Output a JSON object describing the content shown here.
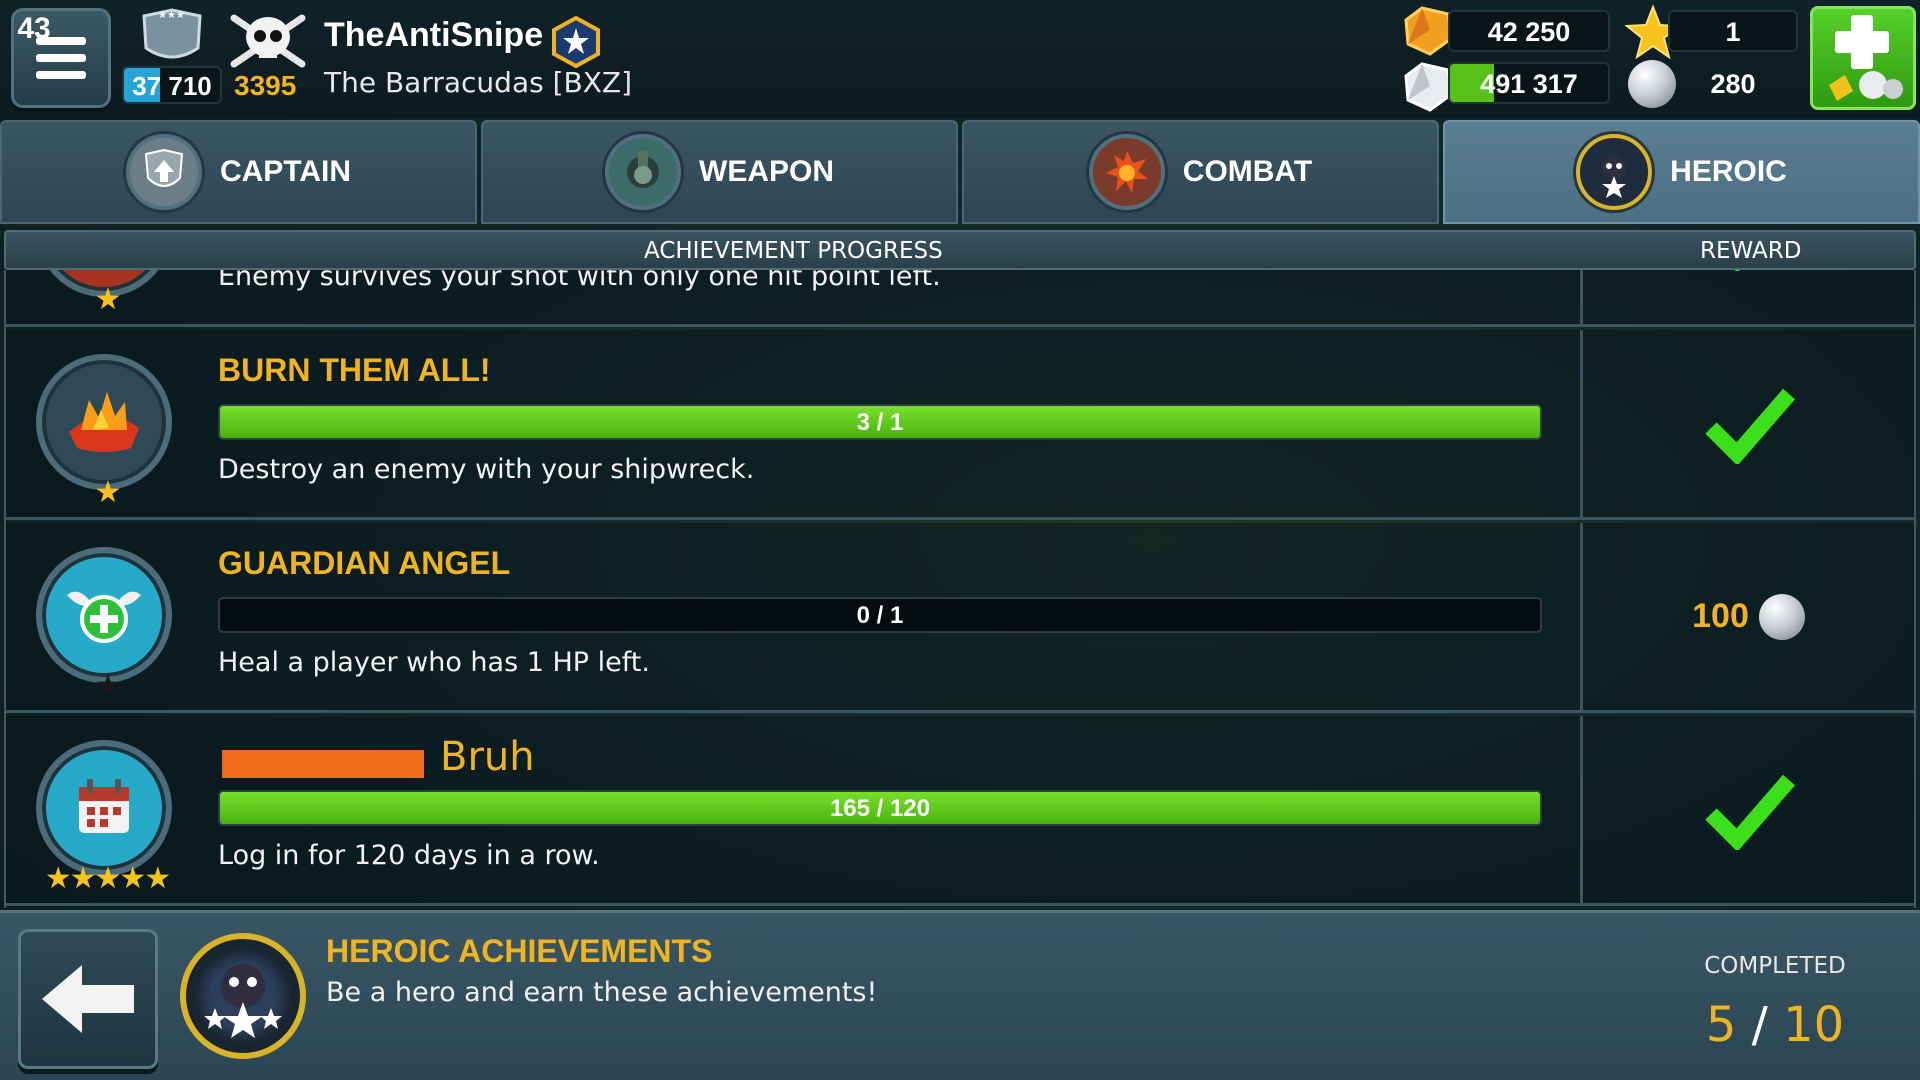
{
  "top_bar": {
    "menu_icon": "hamburger-menu-icon",
    "rank_level": "43",
    "xp_value": "37 710",
    "xp_progress": 0.38,
    "skull_score": "3395",
    "player_name": "TheAntiSnipe",
    "clan_name": "The Barracudas [BXZ]",
    "resources": {
      "gold": "42 250",
      "silver": "491 317",
      "silver_progress": 0.28,
      "stars": "1",
      "pearls": "280"
    },
    "add_button_icon": "plus-icon"
  },
  "tabs": [
    {
      "label": "CAPTAIN",
      "icon": "shield-arrow-icon",
      "active": false
    },
    {
      "label": "WEAPON",
      "icon": "cannon-icon",
      "active": false
    },
    {
      "label": "COMBAT",
      "icon": "explosion-icon",
      "active": false
    },
    {
      "label": "HEROIC",
      "icon": "hero-emblem-icon",
      "active": true
    }
  ],
  "table_header": {
    "progress": "ACHIEVEMENT PROGRESS",
    "reward": "REWARD"
  },
  "achievements": [
    {
      "title": "",
      "description": "Enemy survives your shot with only one hit point left.",
      "stars": "★",
      "reward": "checkmark"
    },
    {
      "title": "BURN THEM ALL!",
      "progress_text": "3 / 1",
      "progress": 1.0,
      "description": "Destroy an enemy with your shipwreck.",
      "stars": "★",
      "reward": "checkmark"
    },
    {
      "title": "GUARDIAN ANGEL",
      "progress_text": "0 / 1",
      "progress": 0.0,
      "description": "Heal a player who has 1 HP left.",
      "stars": "★",
      "reward_amount": "100"
    },
    {
      "title": "Bruh",
      "progress_text": "165 / 120",
      "progress": 1.0,
      "description": "Log in for 120 days in a row.",
      "stars": "★★★★★",
      "reward": "checkmark"
    }
  ],
  "footer": {
    "title": "HEROIC ACHIEVEMENTS",
    "subtitle": "Be a hero and earn these achievements!",
    "completed_label": "COMPLETED",
    "completed_count": "5",
    "completed_sep": "/",
    "completed_total": "10"
  }
}
